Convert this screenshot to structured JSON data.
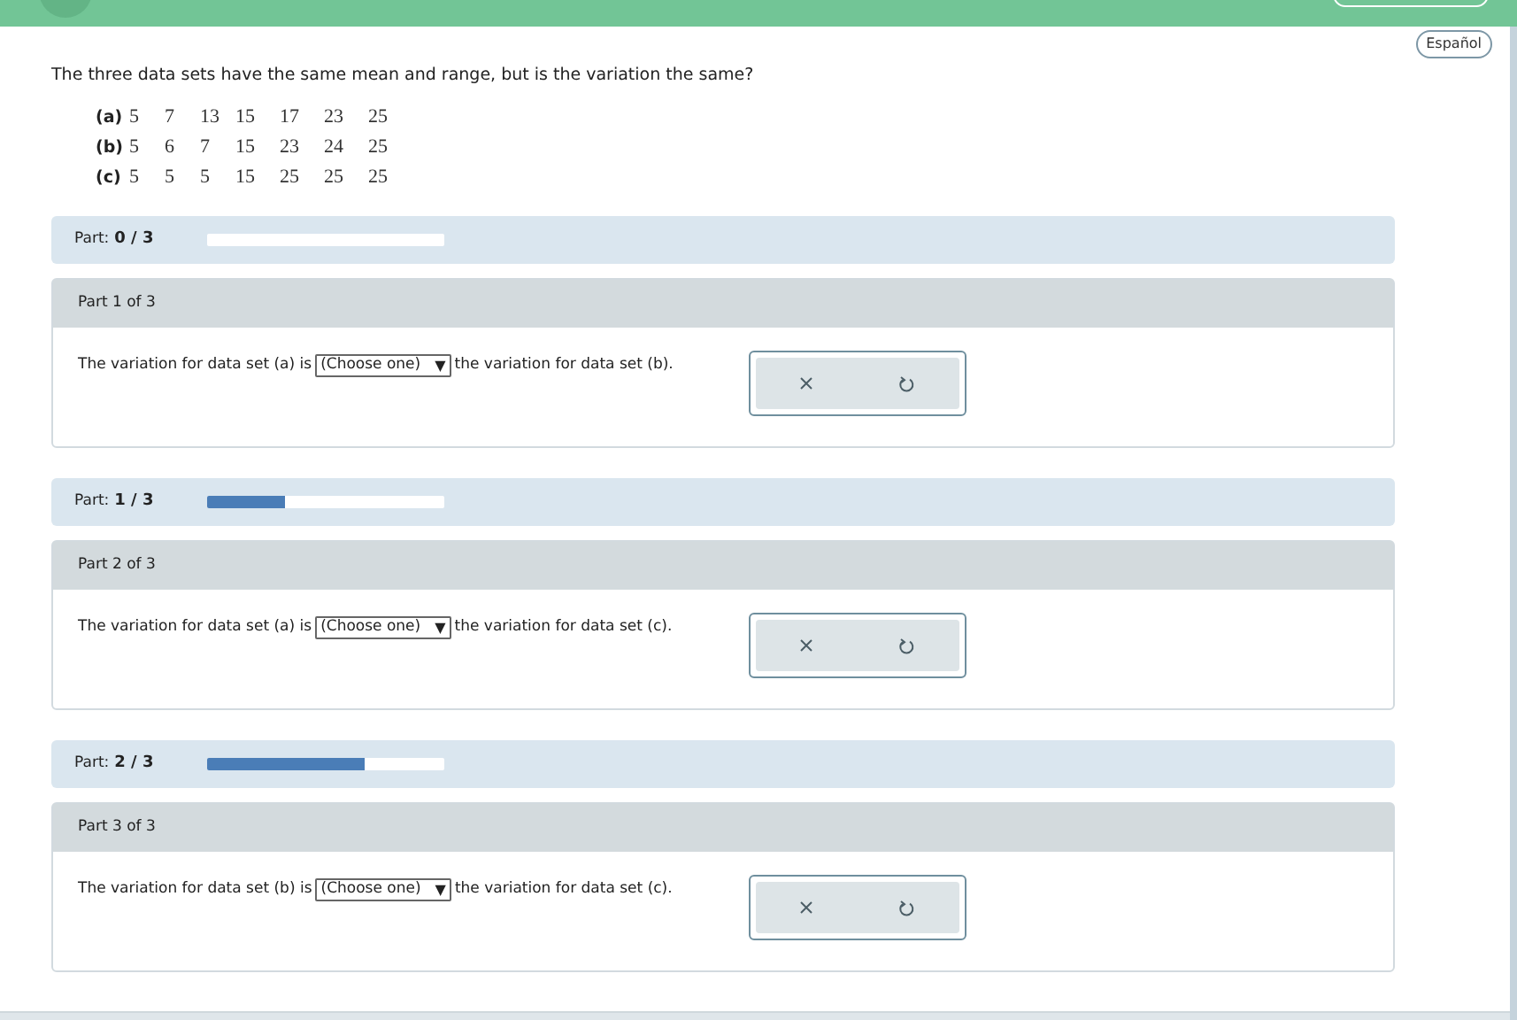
{
  "language_button": "Español",
  "question": "The three data sets have the same mean and range, but is the variation the same?",
  "data_sets": [
    {
      "label": "(a)",
      "values": [
        "5",
        "7",
        "13",
        "15",
        "17",
        "23",
        "25"
      ]
    },
    {
      "label": "(b)",
      "values": [
        "5",
        "6",
        "7",
        "15",
        "23",
        "24",
        "25"
      ]
    },
    {
      "label": "(c)",
      "values": [
        "5",
        "5",
        "5",
        "15",
        "25",
        "25",
        "25"
      ]
    }
  ],
  "parts": [
    {
      "progress_label": "Part:",
      "progress_count": "0 / 3",
      "level": 0,
      "title": "Part 1 of 3",
      "text_before": "The variation for data set (a) is",
      "dropdown": "(Choose one)",
      "dropdown_arrow": "▼",
      "text_after": "the variation for data set (b)."
    },
    {
      "progress_label": "Part:",
      "progress_count": "1 / 3",
      "level": 0.333,
      "title": "Part 2 of 3",
      "text_before": "The variation for data set (a) is",
      "dropdown": "(Choose one)",
      "dropdown_arrow": "▼",
      "text_after": "the variation for data set (c)."
    },
    {
      "progress_label": "Part:",
      "progress_count": "2 / 3",
      "level": 0.667,
      "title": "Part 3 of 3",
      "text_before": "The variation for data set (b) is",
      "dropdown": "(Choose one)",
      "dropdown_arrow": "▼",
      "text_after": "the variation for data set (c)."
    }
  ]
}
